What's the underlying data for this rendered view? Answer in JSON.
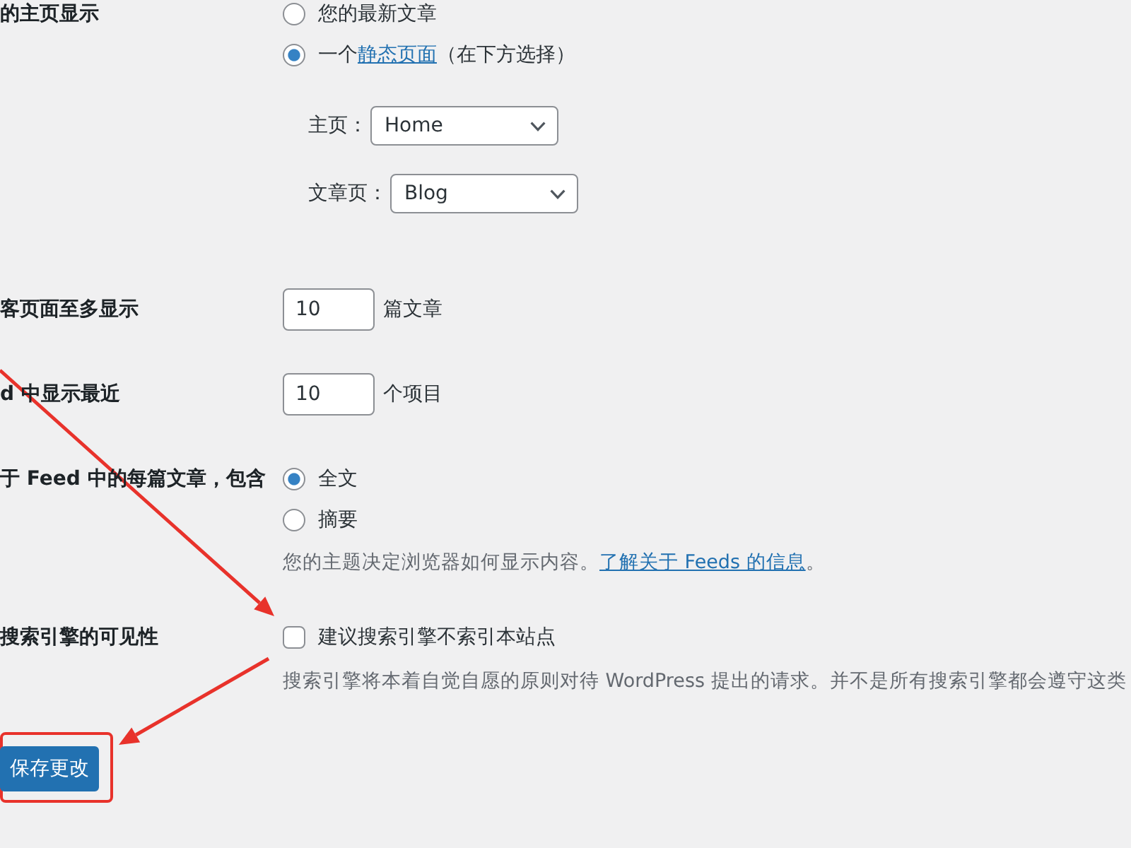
{
  "rows": [
    {
      "kind": "radio",
      "label": "的主页显示",
      "options": [
        {
          "text": "您的最新文章",
          "selected": false
        },
        {
          "text": "一个",
          "link": "静态页面",
          "text_after": "（在下方选择）",
          "selected": true
        }
      ],
      "selects": [
        {
          "label": "主页：",
          "value": "Home"
        },
        {
          "label": "文章页：",
          "value": "Blog"
        }
      ]
    },
    {
      "kind": "number",
      "label": "客页面至多显示",
      "value": "10",
      "unit": "篇文章"
    },
    {
      "kind": "number",
      "label": "d 中显示最近",
      "value": "10",
      "unit": "个项目"
    },
    {
      "kind": "radio",
      "label": "于 Feed 中的每篇文章，包含",
      "options": [
        {
          "text": "全文",
          "selected": true
        },
        {
          "text": "摘要",
          "selected": false
        }
      ],
      "description": {
        "text": "您的主题决定浏览器如何显示内容。",
        "link": "了解关于 Feeds 的信息",
        "text_after": "。"
      }
    },
    {
      "kind": "checkbox",
      "label": "搜索引擎的可见性",
      "text": "建议搜索引擎不索引本站点",
      "checked": false,
      "description": {
        "text": "搜索引擎将本着自觉自愿的原则对待 WordPress 提出的请求。并不是所有搜索引擎都会遵守这类"
      }
    }
  ],
  "save_button": "保存更改"
}
